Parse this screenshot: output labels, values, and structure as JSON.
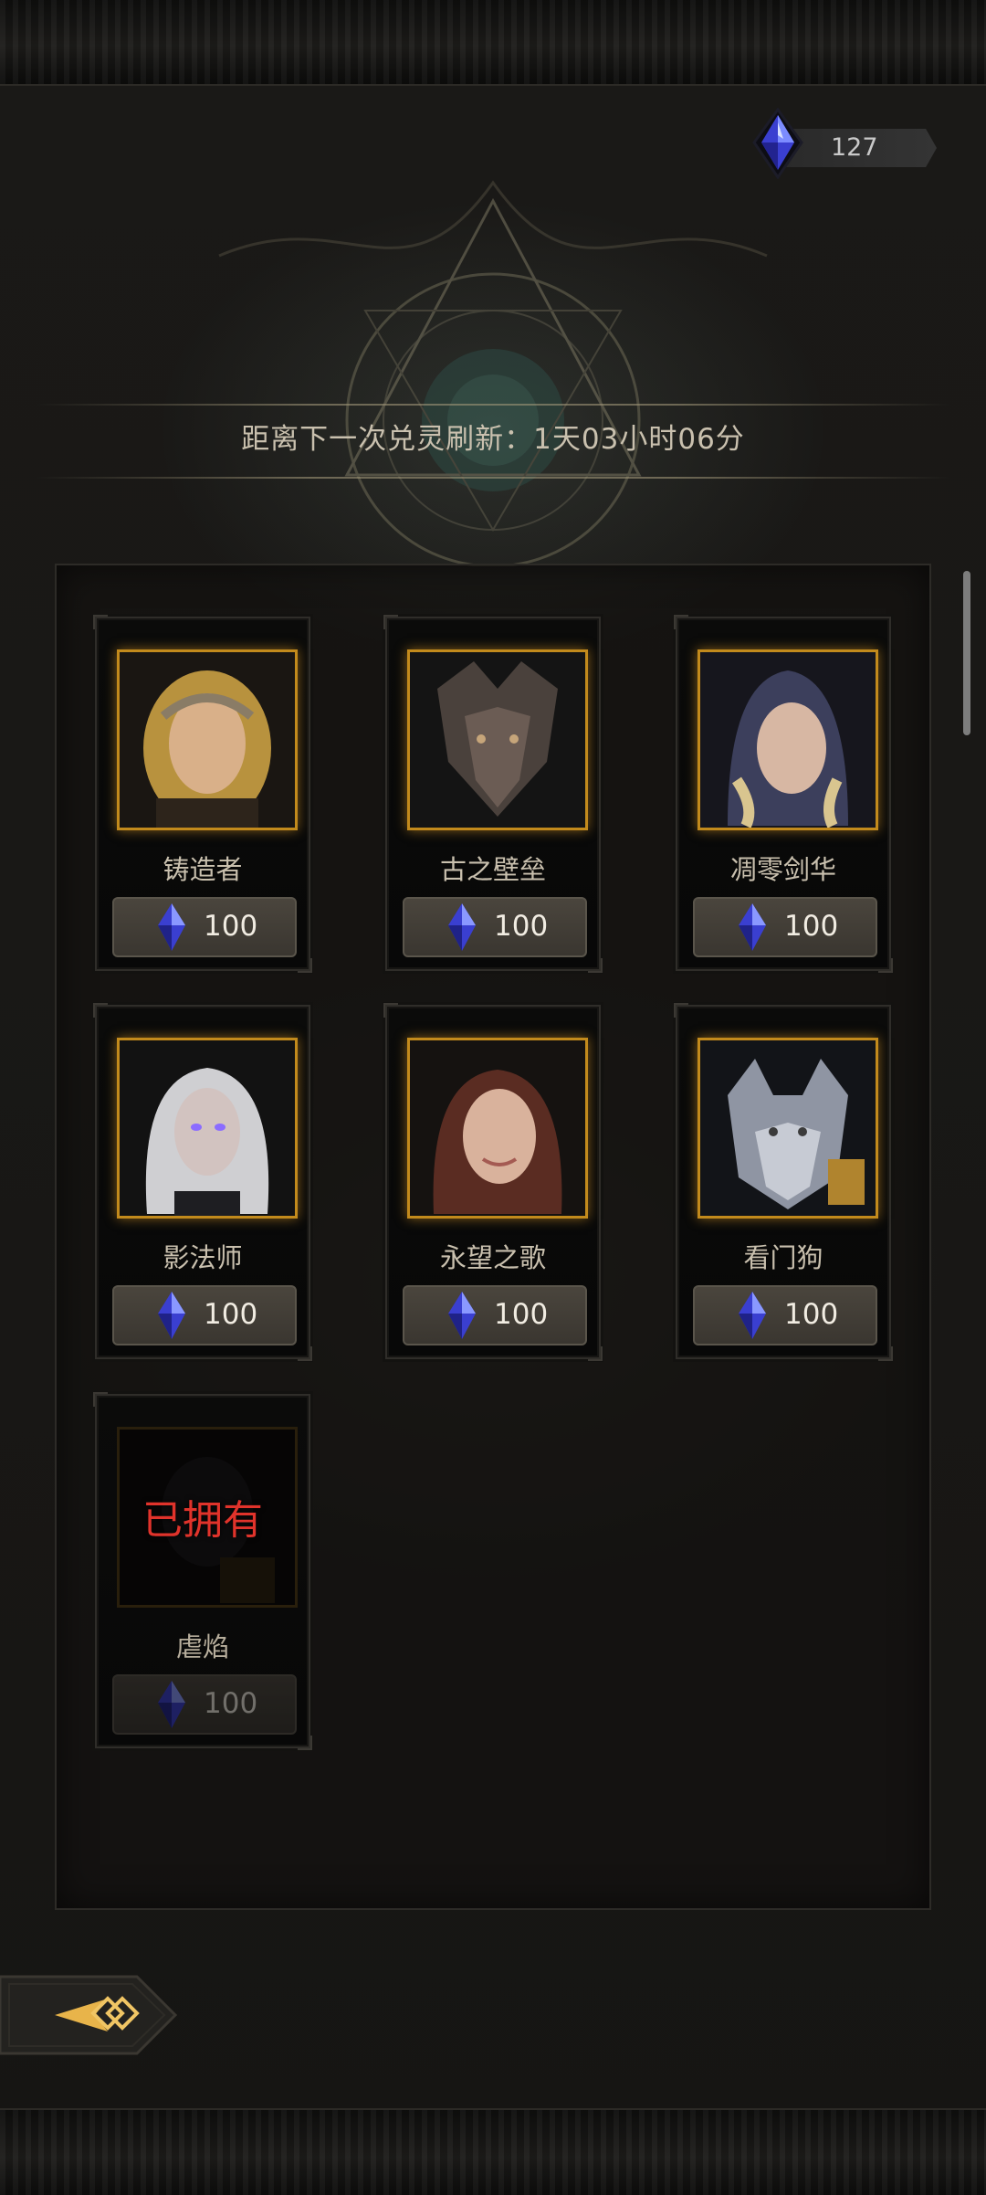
{
  "currency": {
    "icon": "crystal-icon",
    "amount": "127"
  },
  "refresh": {
    "text": "距离下一次兑灵刷新：1天03小时06分"
  },
  "cards": [
    {
      "name": "铸造者",
      "price": "100",
      "owned": false
    },
    {
      "name": "古之壁垒",
      "price": "100",
      "owned": false
    },
    {
      "name": "凋零剑华",
      "price": "100",
      "owned": false
    },
    {
      "name": "影法师",
      "price": "100",
      "owned": false
    },
    {
      "name": "永望之歌",
      "price": "100",
      "owned": false
    },
    {
      "name": "看门狗",
      "price": "100",
      "owned": false
    },
    {
      "name": "虐焰",
      "price": "100",
      "owned": true,
      "owned_label": "已拥有"
    }
  ],
  "colors": {
    "gold_frame": "#c28a1c",
    "owned_red": "#e0332b",
    "crystal_blue": "#3a4fd8"
  }
}
